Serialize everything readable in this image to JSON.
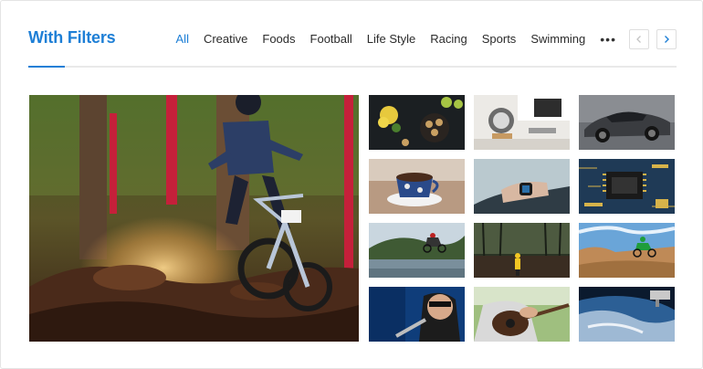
{
  "header": {
    "title": "With Filters"
  },
  "filters": [
    {
      "label": "All",
      "active": true
    },
    {
      "label": "Creative",
      "active": false
    },
    {
      "label": "Foods",
      "active": false
    },
    {
      "label": "Football",
      "active": false
    },
    {
      "label": "Life Style",
      "active": false
    },
    {
      "label": "Racing",
      "active": false
    },
    {
      "label": "Sports",
      "active": false
    },
    {
      "label": "Swimming",
      "active": false
    }
  ],
  "more_label": "•••",
  "nav": {
    "prev_icon": "chevron-left-icon",
    "next_icon": "chevron-right-icon"
  },
  "colors": {
    "accent": "#1e7fd6",
    "text": "#2b2b2b",
    "divider": "#e9e9e9"
  },
  "gallery": {
    "featured": {
      "subject": "mountain-biker"
    },
    "thumbnails": [
      {
        "subject": "food-flatlay"
      },
      {
        "subject": "speaker-desk"
      },
      {
        "subject": "sports-car"
      },
      {
        "subject": "coffee-cup"
      },
      {
        "subject": "smartwatch"
      },
      {
        "subject": "circuit-board"
      },
      {
        "subject": "dirt-bike-jump"
      },
      {
        "subject": "person-in-forest"
      },
      {
        "subject": "motocross"
      },
      {
        "subject": "singer-microphone"
      },
      {
        "subject": "guitar-player"
      },
      {
        "subject": "earth-from-space"
      }
    ]
  }
}
